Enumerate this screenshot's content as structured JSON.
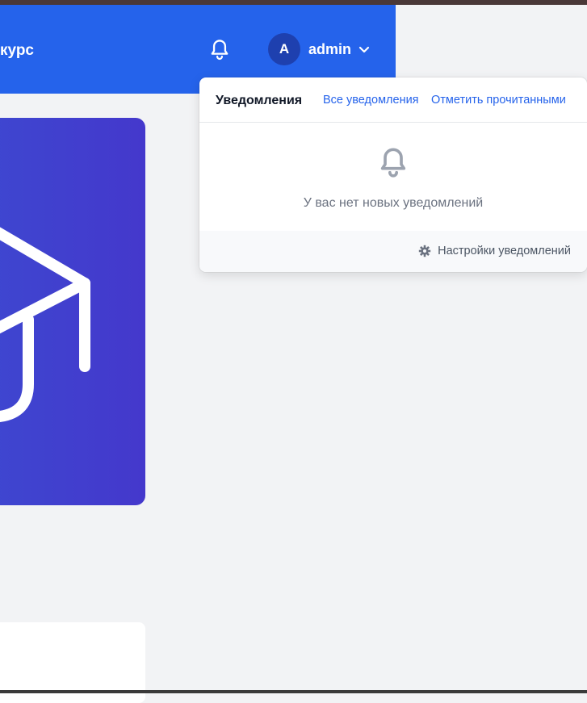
{
  "header": {
    "title": "курс",
    "bell_icon": "bell-icon",
    "user": {
      "avatar_initial": "A",
      "name": "admin",
      "chevron_icon": "chevron-down-icon"
    }
  },
  "hero": {
    "icon": "graduation-cap-icon"
  },
  "notifications": {
    "title": "Уведомления",
    "all_link": "Все уведомления",
    "mark_read_link": "Отметить прочитанными",
    "empty_icon": "bell-icon",
    "empty_text": "У вас нет новых уведомлений",
    "settings_icon": "gear-icon",
    "settings_link": "Настройки уведомлений"
  },
  "colors": {
    "header_bg": "#2563eb",
    "avatar_bg": "#1e40af",
    "hero_bg": "#4338ca",
    "link": "#2563eb",
    "page_bg": "#f2f3f5"
  }
}
